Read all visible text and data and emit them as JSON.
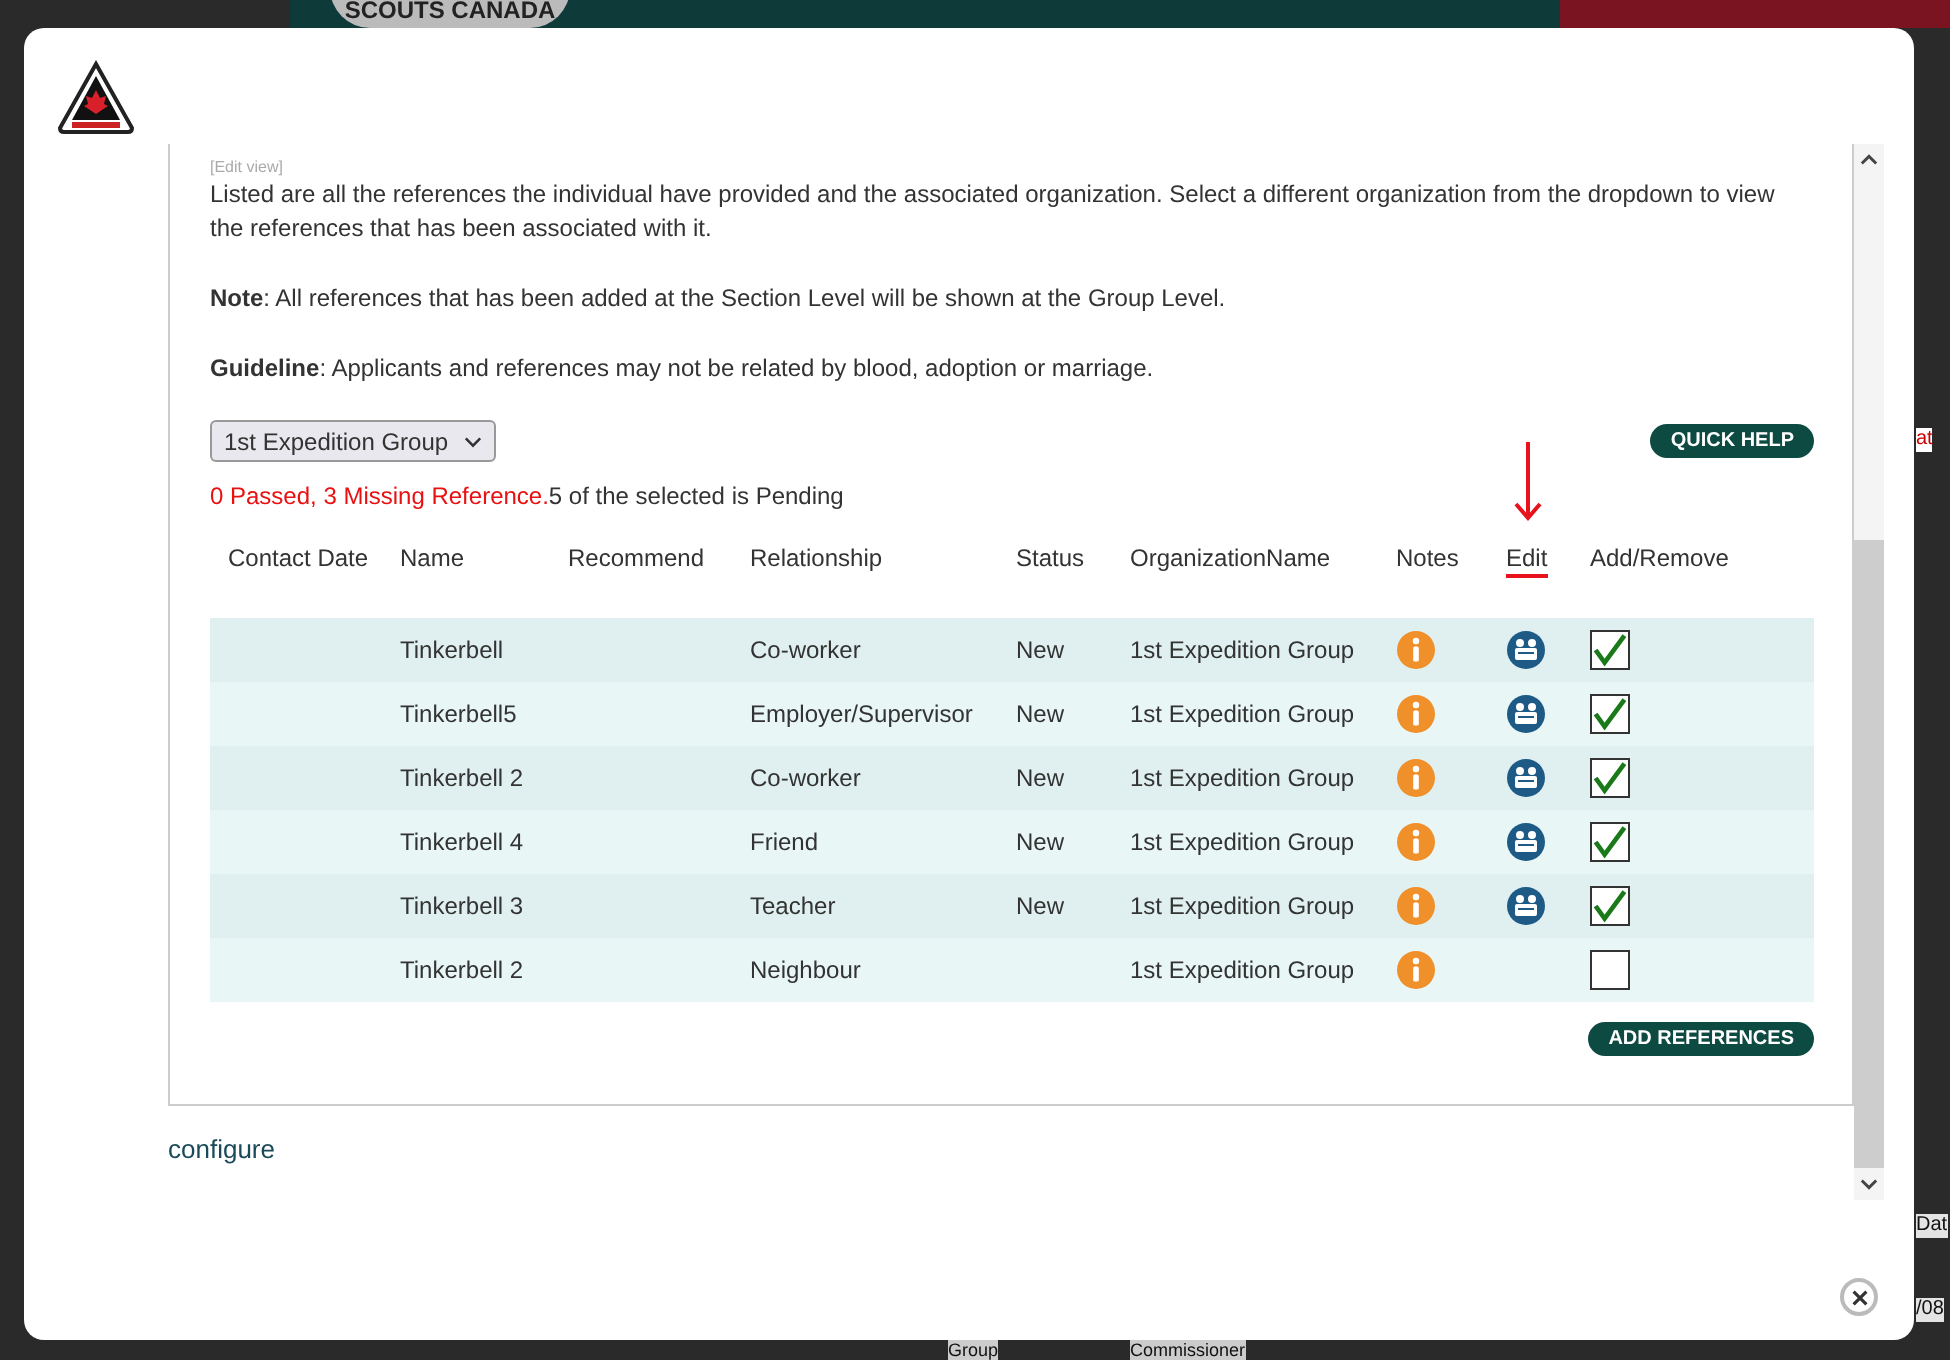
{
  "backdrop": {
    "banner": "SCOUTS CANADA",
    "fragments": [
      "at",
      "Dat",
      "/08"
    ],
    "footer": [
      "Group",
      "Commissioner"
    ]
  },
  "dialog": {
    "view_label": "[Edit view]",
    "intro": "Listed are all the references the individual have provided and the associated organization. Select a different organization from the dropdown to view the references that has been associated with it.",
    "note": "**Note**: All references that has been added at the Section Level will be shown at the Group Level.",
    "guideline": "**Guideline**: Applicants and references may not be related by blood, adoption or marriage.",
    "organization_select": {
      "value": "1st Expedition Group"
    },
    "quick_help": "QUICK HELP",
    "summary": {
      "missing": "0 Passed, 3 Missing Reference.",
      "pending": "5 of the selected is Pending"
    },
    "table": {
      "columns": [
        "Contact Date",
        "Name",
        "Recommend",
        "Relationship",
        "Status",
        "OrganizationName",
        "Notes",
        "Edit",
        "Add/Remove"
      ],
      "rows": [
        {
          "name": "Tinkerbell",
          "relationship": "Co-worker",
          "status": "New",
          "organization": "1st Expedition Group",
          "editable": true,
          "checked": true
        },
        {
          "name": "Tinkerbell5",
          "relationship": "Employer/Supervisor",
          "status": "New",
          "organization": "1st Expedition Group",
          "editable": true,
          "checked": true
        },
        {
          "name": "Tinkerbell 2",
          "relationship": "Co-worker",
          "status": "New",
          "organization": "1st Expedition Group",
          "editable": true,
          "checked": true
        },
        {
          "name": "Tinkerbell 4",
          "relationship": "Friend",
          "status": "New",
          "organization": "1st Expedition Group",
          "editable": true,
          "checked": true
        },
        {
          "name": "Tinkerbell 3",
          "relationship": "Teacher",
          "status": "New",
          "organization": "1st Expedition Group",
          "editable": true,
          "checked": true
        },
        {
          "name": "Tinkerbell 2",
          "relationship": "Neighbour",
          "organization": "1st Expedition Group",
          "editable": false,
          "checked": false
        }
      ]
    },
    "add_references": "ADD REFERENCES",
    "configure": "configure"
  }
}
